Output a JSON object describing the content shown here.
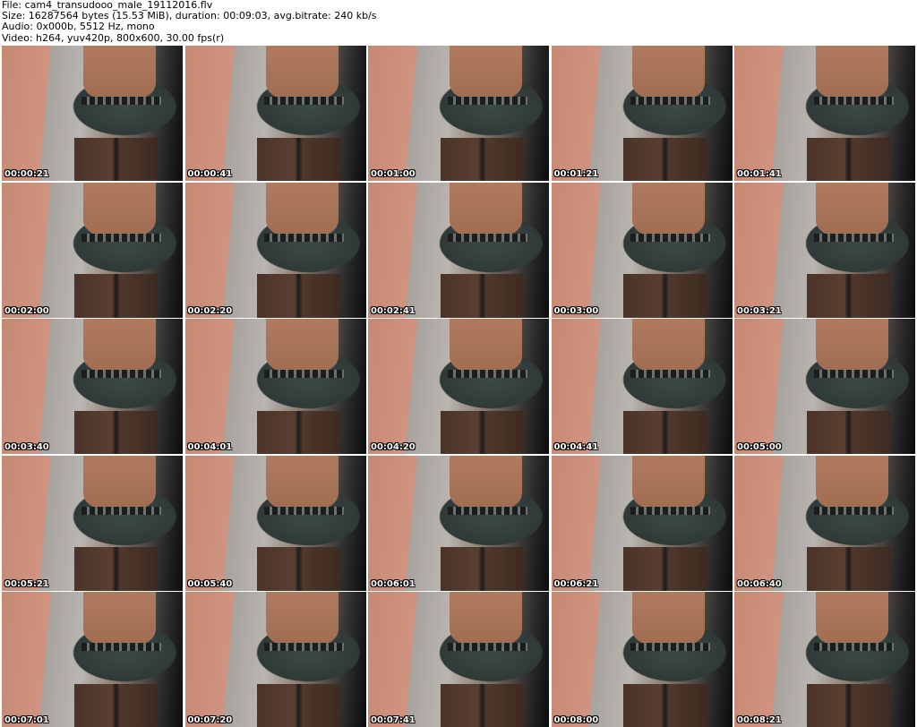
{
  "header": {
    "file": "File: cam4_transudooo_male_19112016.flv",
    "size": "Size: 16287564 bytes (15.53 MiB), duration: 00:09:03, avg.bitrate: 240 kb/s",
    "audio": "Audio: 0x000b, 5512 Hz, mono",
    "video": "Video: h264, yuv420p, 800x600, 30.00 fps(r)"
  },
  "thumbnails": [
    {
      "time": "00:00:21"
    },
    {
      "time": "00:00:41"
    },
    {
      "time": "00:01:00"
    },
    {
      "time": "00:01:21"
    },
    {
      "time": "00:01:41"
    },
    {
      "time": "00:02:00"
    },
    {
      "time": "00:02:20"
    },
    {
      "time": "00:02:41"
    },
    {
      "time": "00:03:00"
    },
    {
      "time": "00:03:21"
    },
    {
      "time": "00:03:40"
    },
    {
      "time": "00:04:01"
    },
    {
      "time": "00:04:20"
    },
    {
      "time": "00:04:41"
    },
    {
      "time": "00:05:00"
    },
    {
      "time": "00:05:21"
    },
    {
      "time": "00:05:40"
    },
    {
      "time": "00:06:01"
    },
    {
      "time": "00:06:21"
    },
    {
      "time": "00:06:40"
    },
    {
      "time": "00:07:01"
    },
    {
      "time": "00:07:20"
    },
    {
      "time": "00:07:41"
    },
    {
      "time": "00:08:00"
    },
    {
      "time": "00:08:21"
    }
  ]
}
